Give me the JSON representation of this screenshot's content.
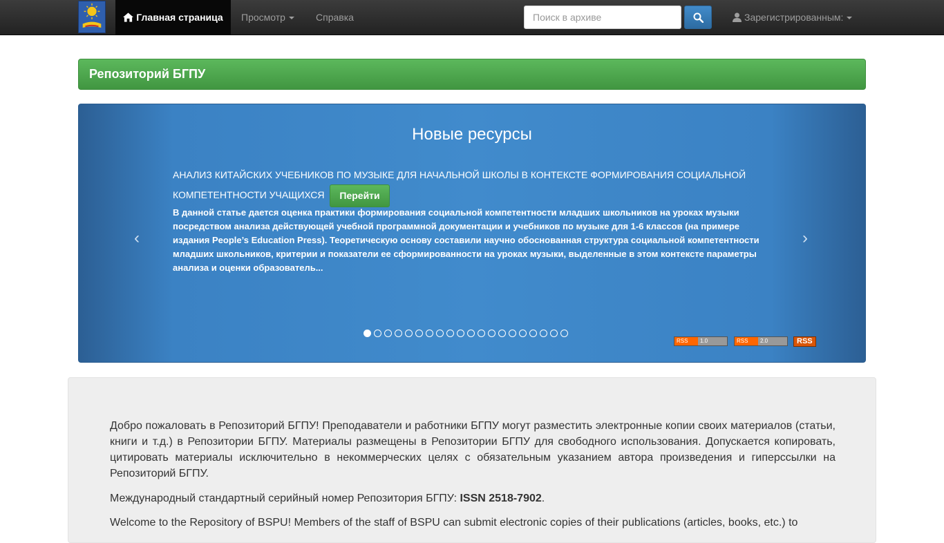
{
  "navbar": {
    "home_label": "Главная страница",
    "browse_label": "Просмотр",
    "help_label": "Справка",
    "search_placeholder": "Поиск в архиве",
    "user_label": "Зарегистрированным:"
  },
  "title_bar": {
    "title": "Репозиторий БГПУ"
  },
  "carousel": {
    "heading": "Новые ресурсы",
    "item_title": "АНАЛИЗ КИТАЙСКИХ УЧЕБНИКОВ ПО МУЗЫКЕ ДЛЯ НАЧАЛЬНОЙ ШКОЛЫ В КОНТЕКСТЕ ФОРМИРОВАНИЯ СОЦИАЛЬНОЙ КОМПЕТЕНТНОСТИ УЧАЩИХСЯ",
    "go_label": "Перейти",
    "abstract": "В данной статье дается оценка практики формирования социальной компетентности младших школьников на уроках музыки посредством анализа действующей учебной программной документации и учебников по музыке для 1-6 классов (на примере издания People’s Education Press). Теоретическую основу составили научно обоснованная структура социальной компетентности младших школьников, критерии и показатели ее сформированности на уроках музыки, выделенные в этом контексте параметры анализа и оценки образователь...",
    "prev_label": "‹",
    "next_label": "›",
    "slide_count": 20,
    "active_slide": 0,
    "rss": [
      {
        "left": "RSS",
        "right": "1.0"
      },
      {
        "left": "RSS",
        "right": "2.0"
      }
    ],
    "rss_plain": "RSS"
  },
  "welcome": {
    "paragraph_ru": "Добро пожаловать в Репозиторий БГПУ! Преподаватели и работники БГПУ могут разместить электронные копии своих материалов (статьи, книги и т.д.) в Репозитории БГПУ. Материалы размещены в Репозитории БГПУ для свободного использования. Допускается копировать, цитировать материалы исключительно в некоммерческих целях с обязательным указанием автора произведения и гиперссылки на Репозиторий БГПУ.",
    "issn_prefix": "Международный стандартный серийный номер Репозитория БГПУ: ",
    "issn_value": "ISSN 2518-7902",
    "issn_suffix": ".",
    "paragraph_en": "Welcome to the Repository of BSPU! Members of the staff of BSPU can submit electronic copies of their publications (articles, books, etc.) to"
  },
  "colors": {
    "navbar": "#222222",
    "title_green": "#5cb85c",
    "carousel_blue": "#418bcc",
    "search_blue": "#428bca"
  }
}
